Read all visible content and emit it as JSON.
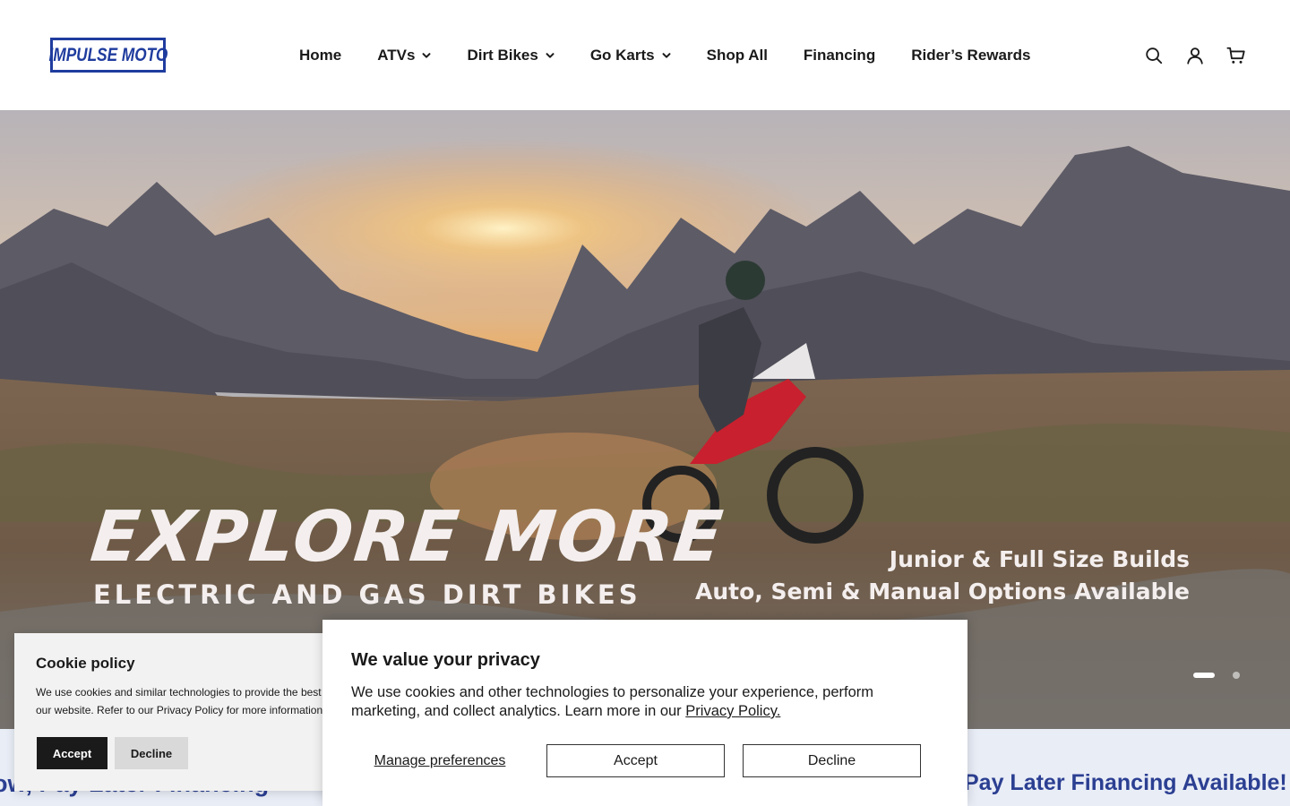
{
  "brand": {
    "logo_text": "IMPULSE MOTO",
    "color": "#1f3c9e"
  },
  "nav": {
    "items": [
      {
        "label": "Home",
        "dropdown": false
      },
      {
        "label": "ATVs",
        "dropdown": true
      },
      {
        "label": "Dirt Bikes",
        "dropdown": true
      },
      {
        "label": "Go Karts",
        "dropdown": true
      },
      {
        "label": "Shop All",
        "dropdown": false
      },
      {
        "label": "Financing",
        "dropdown": false
      },
      {
        "label": "Rider’s Rewards",
        "dropdown": false
      }
    ]
  },
  "header_icons": [
    "search-icon",
    "account-icon",
    "cart-icon"
  ],
  "hero": {
    "title": "EXPLORE MORE",
    "subtitle": "ELECTRIC AND GAS DIRT BIKES",
    "right_line1": "Junior & Full Size Builds",
    "right_line2": "Auto, Semi & Manual Options Available",
    "slide_count": 2,
    "active_slide": 1
  },
  "strip": {
    "left_text": "ow, Pay Later Financing",
    "right_text": "Pay Later Financing Available!",
    "color": "#2b3f92"
  },
  "cookie_policy": {
    "title": "Cookie policy",
    "line1": "We use cookies and similar technologies to provide the best e",
    "line2": "our website. Refer to our Privacy Policy for more information.",
    "accept_label": "Accept",
    "decline_label": "Decline"
  },
  "privacy_modal": {
    "title": "We value your privacy",
    "body": "We use cookies and other technologies to personalize your experience, perform marketing, and collect analytics. Learn more in our",
    "link_text": "Privacy Policy.",
    "manage_label": "Manage preferences",
    "accept_label": "Accept",
    "decline_label": "Decline"
  }
}
